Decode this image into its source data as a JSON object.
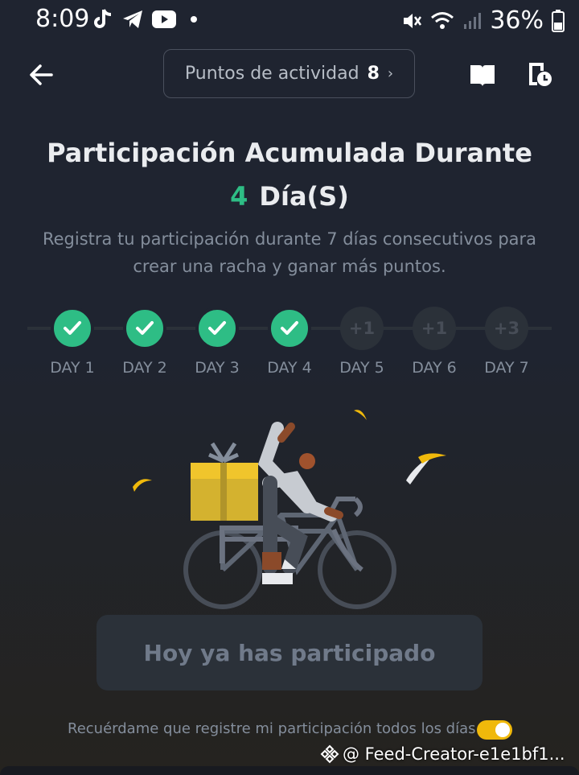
{
  "status_bar": {
    "time": "8:09",
    "battery": "36%"
  },
  "header": {
    "activity_label": "Puntos de actividad",
    "activity_points": "8",
    "chevron": "›"
  },
  "title": {
    "line1": "Participación Acumulada Durante",
    "days": "4",
    "unit": "Día(S)"
  },
  "subtitle": "Registra tu participación durante 7 días consecutivos para crear una racha y ganar más puntos.",
  "days": [
    {
      "label": "DAY 1",
      "status": "done",
      "reward": ""
    },
    {
      "label": "DAY 2",
      "status": "done",
      "reward": ""
    },
    {
      "label": "DAY 3",
      "status": "done",
      "reward": ""
    },
    {
      "label": "DAY 4",
      "status": "done",
      "reward": ""
    },
    {
      "label": "DAY 5",
      "status": "pending",
      "reward": "+1"
    },
    {
      "label": "DAY 6",
      "status": "pending",
      "reward": "+1"
    },
    {
      "label": "DAY 7",
      "status": "pending",
      "reward": "+3"
    }
  ],
  "button_label": "Hoy ya has participado",
  "reminder_label": "Recuérdame que registre mi participación todos los días",
  "reminder_enabled": true,
  "watermark": "@ Feed-Creator-e1e1bf1...",
  "colors": {
    "accent_green": "#2ebd85",
    "accent_yellow": "#f0b90b",
    "background": "#1f2430"
  },
  "icons": [
    "tiktok-icon",
    "telegram-icon",
    "youtube-icon",
    "mute-icon",
    "wifi-icon",
    "signal-icon",
    "battery-icon",
    "back-arrow-icon",
    "book-icon",
    "history-icon",
    "check-icon",
    "binance-logo-icon"
  ]
}
